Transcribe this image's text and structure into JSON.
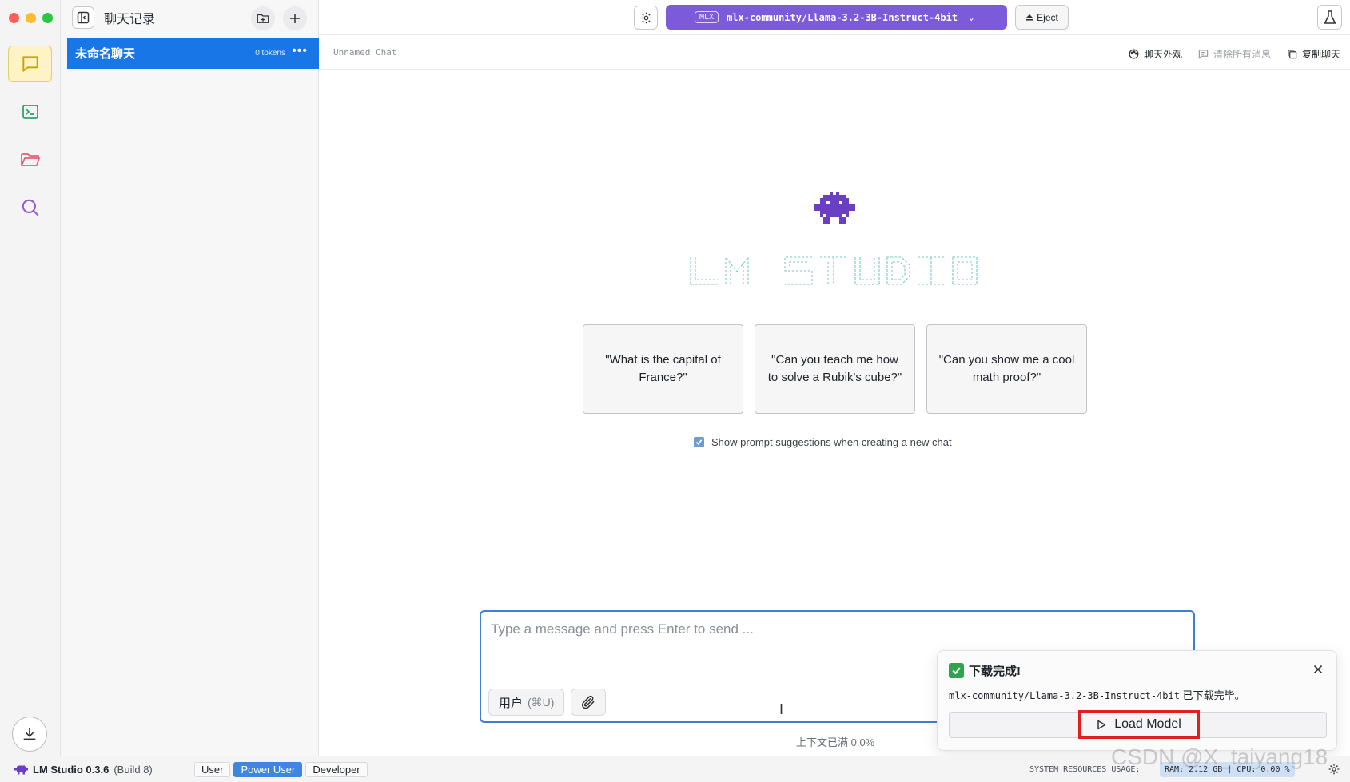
{
  "sidebar": {
    "title": "聊天记录",
    "chats": [
      {
        "name": "未命名聊天",
        "tokens": "0 tokens"
      }
    ]
  },
  "topbar": {
    "model_tag": "MLX",
    "model_name": "mlx-community/Llama-3.2-3B-Instruct-4bit",
    "eject_label": "Eject"
  },
  "subheader": {
    "chat_title": "Unnamed Chat",
    "actions": [
      "聊天外观",
      "清除所有消息",
      "复制聊天"
    ]
  },
  "main": {
    "suggestions": [
      "\"What is the capital of France?\"",
      "\"Can you teach me how to solve a Rubik's cube?\"",
      "\"Can you show me a cool math proof?\""
    ],
    "suggestion_toggle_label": "Show prompt suggestions when creating a new chat",
    "suggestion_toggle_checked": true
  },
  "composer": {
    "placeholder": "Type a message and press Enter to send ...",
    "role_label": "用户",
    "role_shortcut": "(⌘U)",
    "context_status": "上下文已满 0.0%"
  },
  "toast": {
    "title": "下载完成!",
    "model": "mlx-community/Llama-3.2-3B-Instruct-4bit",
    "message_suffix": " 已下载完毕。",
    "action_label": "Load Model"
  },
  "statusbar": {
    "app_name": "LM Studio 0.3.6",
    "build": "(Build 8)",
    "modes": [
      "User",
      "Power User",
      "Developer"
    ],
    "active_mode": "Power User",
    "resources_label": "SYSTEM RESOURCES USAGE:",
    "ram": "RAM: 2.12 GB",
    "cpu": "CPU: 0.00 %"
  },
  "watermark": "CSDN @X_taiyang18",
  "colors": {
    "accent": "#1976e6",
    "model_pill": "#7b5bd9",
    "highlight_box": "#e0201e",
    "success": "#2ea44f"
  },
  "icons": {
    "rail": [
      "chat-icon",
      "terminal-icon",
      "folder-icon",
      "search-icon"
    ],
    "mascot": "robot-mascot-icon"
  }
}
